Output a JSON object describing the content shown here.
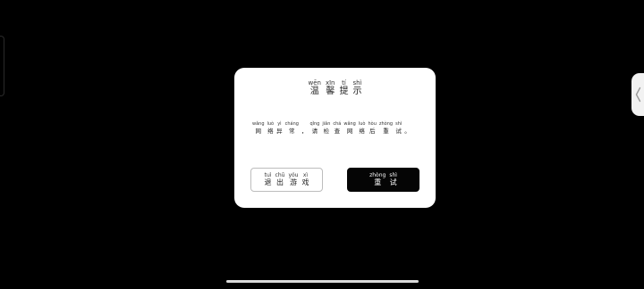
{
  "dialog": {
    "title": [
      {
        "py": "wēn",
        "hz": "温"
      },
      {
        "py": "xīn",
        "hz": "馨"
      },
      {
        "py": "tí",
        "hz": "提"
      },
      {
        "py": "shì",
        "hz": "示"
      }
    ],
    "message": [
      {
        "py": "wǎng",
        "hz": "网"
      },
      {
        "py": "luò",
        "hz": "络"
      },
      {
        "py": "yì",
        "hz": "异"
      },
      {
        "py": "cháng",
        "hz": "常"
      },
      {
        "py": "",
        "hz": "，"
      },
      {
        "py": "qǐng",
        "hz": "请"
      },
      {
        "py": "jiǎn",
        "hz": "检"
      },
      {
        "py": "chá",
        "hz": "查"
      },
      {
        "py": "wǎng",
        "hz": "网"
      },
      {
        "py": "luò",
        "hz": "络"
      },
      {
        "py": "hòu",
        "hz": "后"
      },
      {
        "py": "zhòng",
        "hz": "重"
      },
      {
        "py": "shì",
        "hz": "试"
      },
      {
        "py": "",
        "hz": "。"
      }
    ],
    "exit_button": [
      {
        "py": "tuì",
        "hz": "退"
      },
      {
        "py": "chū",
        "hz": "出"
      },
      {
        "py": "yóu",
        "hz": "游"
      },
      {
        "py": "xì",
        "hz": "戏"
      }
    ],
    "retry_button": [
      {
        "py": "zhòng",
        "hz": "重"
      },
      {
        "py": "shì",
        "hz": "试"
      }
    ]
  },
  "side_tab": {
    "icon": "chevron-left-icon"
  },
  "colors": {
    "background": "#000000",
    "dialog": "#ffffff",
    "primary_button": "#050505",
    "secondary_border": "#bdbdbd"
  }
}
